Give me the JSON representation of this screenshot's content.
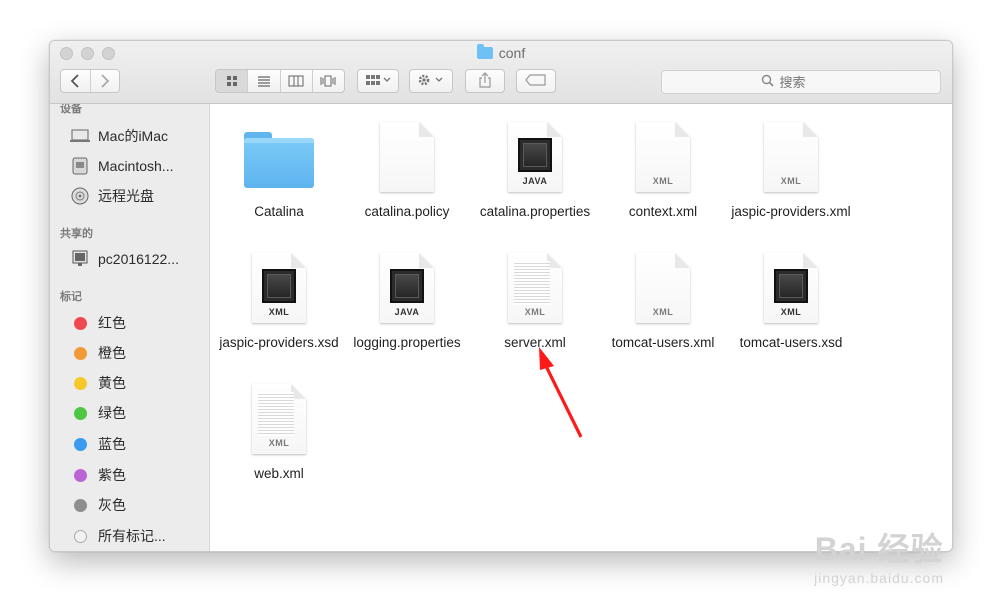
{
  "window": {
    "title": "conf",
    "folder_icon": "folder-icon"
  },
  "toolbar": {
    "search_placeholder": "搜索",
    "icons": [
      "back-icon",
      "forward-icon",
      "icon-view-icon",
      "list-view-icon",
      "column-view-icon",
      "coverflow-view-icon",
      "arrange-icon",
      "action-gear-icon",
      "share-icon",
      "tag-icon",
      "search-icon"
    ]
  },
  "sidebar": {
    "devices_header": "设备",
    "devices": [
      {
        "label": "Mac的iMac",
        "icon": "computer-icon"
      },
      {
        "label": "Macintosh...",
        "icon": "hard-drive-icon"
      },
      {
        "label": "远程光盘",
        "icon": "remote-disc-icon"
      }
    ],
    "shared_header": "共享的",
    "shared": [
      {
        "label": "pc2016122...",
        "icon": "network-computer-icon"
      }
    ],
    "tags_header": "标记",
    "tags": [
      {
        "label": "红色",
        "color": "#f0484f"
      },
      {
        "label": "橙色",
        "color": "#f29a36"
      },
      {
        "label": "黄色",
        "color": "#f5c92a"
      },
      {
        "label": "绿色",
        "color": "#4fc744"
      },
      {
        "label": "蓝色",
        "color": "#3b9af0"
      },
      {
        "label": "紫色",
        "color": "#b966d4"
      },
      {
        "label": "灰色",
        "color": "#8e8e8e"
      }
    ],
    "all_tags_label": "所有标记..."
  },
  "files": [
    {
      "name": "Catalina",
      "type": "folder"
    },
    {
      "name": "catalina.policy",
      "type": "blank"
    },
    {
      "name": "catalina.properties",
      "type": "exec",
      "badge": "JAVA"
    },
    {
      "name": "context.xml",
      "type": "doc",
      "badge": "XML"
    },
    {
      "name": "jaspic-providers.xml",
      "type": "doc",
      "badge": "XML"
    },
    {
      "name": "jaspic-providers.xsd",
      "type": "exec",
      "badge": "XML"
    },
    {
      "name": "logging.properties",
      "type": "exec",
      "badge": "JAVA"
    },
    {
      "name": "server.xml",
      "type": "text",
      "badge": "XML"
    },
    {
      "name": "tomcat-users.xml",
      "type": "doc",
      "badge": "XML"
    },
    {
      "name": "tomcat-users.xsd",
      "type": "exec",
      "badge": "XML"
    },
    {
      "name": "web.xml",
      "type": "text",
      "badge": "XML"
    }
  ],
  "annotation": {
    "arrow_color": "#ff1a1a"
  },
  "watermark": {
    "line1": "Bai 经验",
    "line2": "jingyan.baidu.com"
  }
}
